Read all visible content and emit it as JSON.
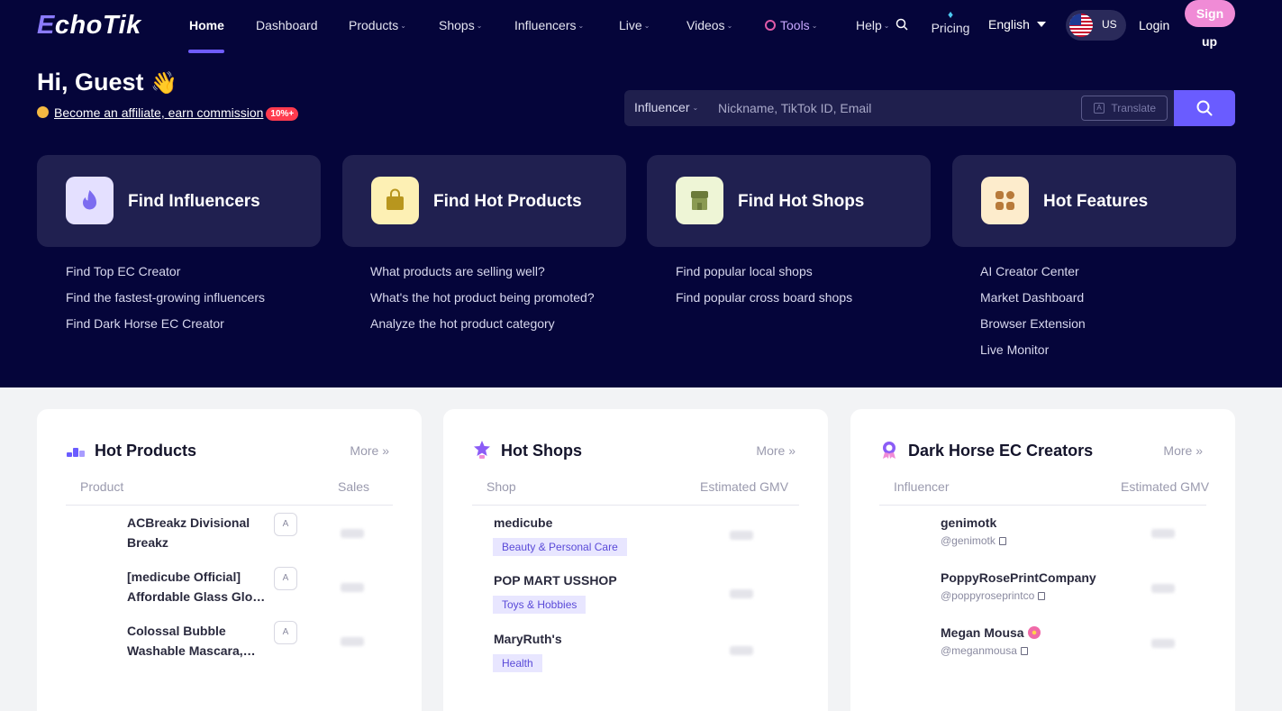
{
  "brand": {
    "logo_e": "E",
    "logo_rest": "choTik"
  },
  "nav": {
    "items": [
      {
        "label": "Home",
        "active": true
      },
      {
        "label": "Dashboard"
      },
      {
        "label": "Products"
      },
      {
        "label": "Shops"
      },
      {
        "label": "Influencers"
      },
      {
        "label": "Live"
      },
      {
        "label": "Videos"
      },
      {
        "label": "Tools"
      },
      {
        "label": "Help"
      }
    ],
    "pricing": "Pricing",
    "language": "English",
    "region": "US",
    "login": "Login",
    "signup_line1": "Sign",
    "signup_line2": "up"
  },
  "greeting": {
    "title": "Hi, Guest",
    "affiliate_text": "Become an affiliate, earn commission",
    "badge": "10%+"
  },
  "search": {
    "type": "Influencer",
    "placeholder": "Nickname, TikTok ID, Email",
    "translate": "Translate"
  },
  "features": [
    {
      "title": "Find Influencers",
      "links": [
        "Find Top EC Creator",
        "Find the fastest-growing influencers",
        "Find Dark Horse EC Creator"
      ]
    },
    {
      "title": "Find Hot Products",
      "links": [
        "What products are selling well?",
        "What's the hot product being promoted?",
        "Analyze the hot product category"
      ]
    },
    {
      "title": "Find Hot Shops",
      "links": [
        "Find popular local shops",
        "Find popular cross board shops"
      ]
    },
    {
      "title": "Hot Features",
      "links": [
        "AI Creator Center",
        "Market Dashboard",
        "Browser Extension",
        "Live Monitor"
      ]
    }
  ],
  "panels": {
    "products": {
      "title": "Hot Products",
      "more": "More",
      "col1": "Product",
      "col2": "Sales",
      "rows": [
        {
          "name": "ACBreakz Divisional Breakz"
        },
        {
          "name": "[medicube Official] Affordable Glass Glow Skincare Set"
        },
        {
          "name": "Colossal Bubble Washable Mascara, Waterproof"
        }
      ]
    },
    "shops": {
      "title": "Hot Shops",
      "more": "More",
      "col1": "Shop",
      "col2": "Estimated GMV",
      "rows": [
        {
          "name": "medicube",
          "tag": "Beauty & Personal Care"
        },
        {
          "name": "POP MART USSHOP",
          "tag": "Toys & Hobbies"
        },
        {
          "name": "MaryRuth's",
          "tag": "Health"
        }
      ]
    },
    "creators": {
      "title": "Dark Horse EC Creators",
      "more": "More",
      "col1": "Influencer",
      "col2": "Estimated GMV",
      "rows": [
        {
          "name": "genimotk",
          "handle": "@genimotk"
        },
        {
          "name": "PoppyRosePrintCompany",
          "handle": "@poppyroseprintco"
        },
        {
          "name": "Megan Mousa",
          "handle": "@meganmousa"
        }
      ]
    }
  },
  "colors": {
    "hero_bg": "#05053a",
    "accent": "#6a5cff",
    "card_bg": "#202050",
    "signup": "#f08bd6",
    "badge": "#ff3b4e"
  }
}
